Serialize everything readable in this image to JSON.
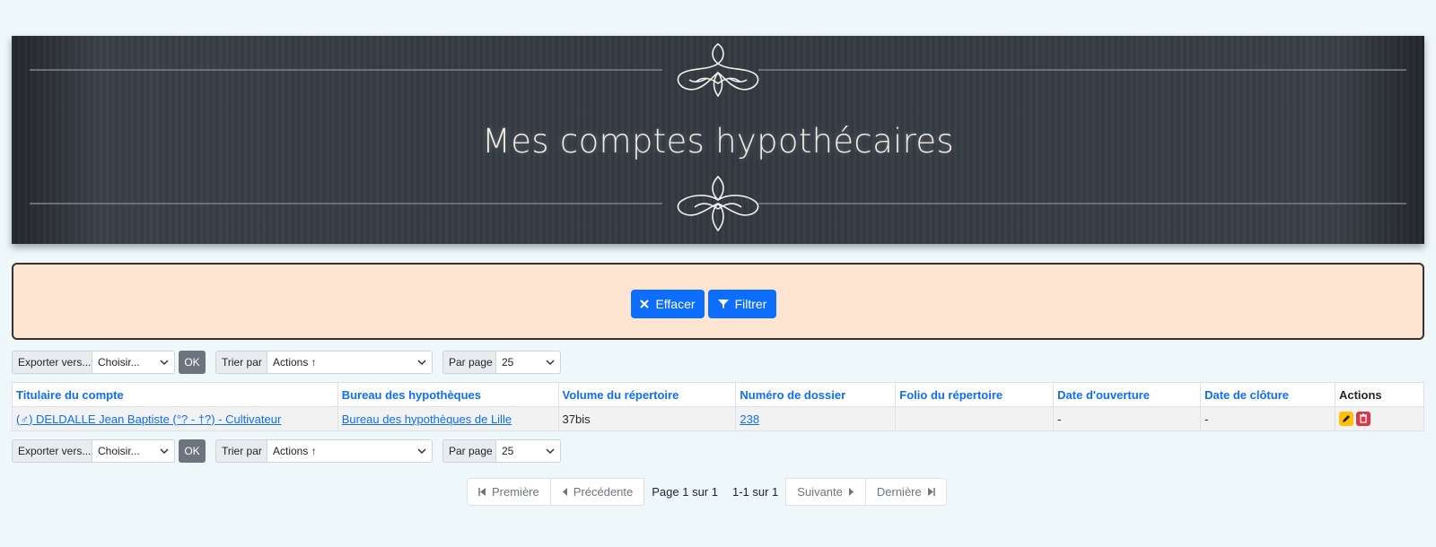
{
  "banner": {
    "title": "Mes comptes hypothécaires"
  },
  "filter": {
    "clear_label": "Effacer",
    "filter_label": "Filtrer"
  },
  "toolbar": {
    "export_label": "Exporter vers...",
    "export_value": "Choisir...",
    "ok_label": "OK",
    "sort_label": "Trier par",
    "sort_value": "Actions ↑",
    "perpage_label": "Par page",
    "perpage_value": "25"
  },
  "table": {
    "headers": [
      "Titulaire du compte",
      "Bureau des hypothèques",
      "Volume du répertoire",
      "Numéro de dossier",
      "Folio du répertoire",
      "Date d'ouverture",
      "Date de clôture",
      "Actions"
    ],
    "rows": [
      {
        "holder": "(♂) DELDALLE Jean Baptiste (°? - †?) - Cultivateur",
        "bureau": "Bureau des hypothèques de Lille",
        "volume": "37bis",
        "dossier": "238",
        "folio": "",
        "opening": "-",
        "closing": "-"
      }
    ]
  },
  "pagination": {
    "first": "Première",
    "prev": "Précédente",
    "page_info": "Page 1 sur 1",
    "range_info": "1-1 sur 1",
    "next": "Suivante",
    "last": "Dernière"
  },
  "colors": {
    "primary": "#0d6efd",
    "edit": "#ffc107",
    "delete": "#dc3545",
    "filter_bg": "#fee5d1"
  }
}
